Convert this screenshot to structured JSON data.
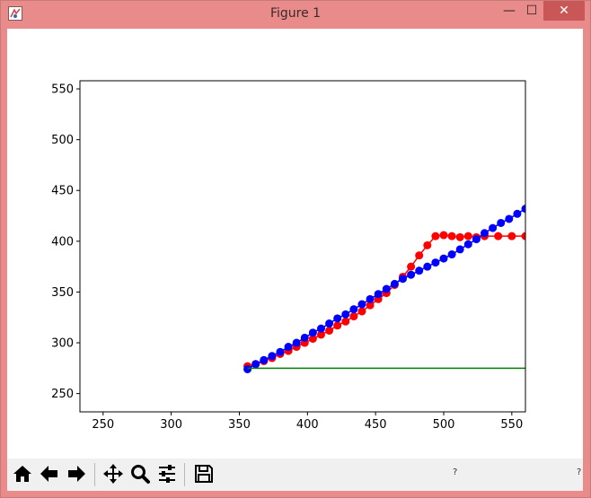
{
  "window": {
    "title": "Figure 1"
  },
  "controls": {
    "minimize": "—",
    "maximize": "☐",
    "close": "✕"
  },
  "toolbar": {
    "buttons": [
      {
        "name": "home-button",
        "icon": "home-icon"
      },
      {
        "name": "back-button",
        "icon": "arrow-left-icon"
      },
      {
        "name": "forward-button",
        "icon": "arrow-right-icon"
      },
      {
        "name": "pan-button",
        "icon": "move-icon"
      },
      {
        "name": "zoom-button",
        "icon": "magnifier-icon"
      },
      {
        "name": "configure-subplots-button",
        "icon": "sliders-icon"
      },
      {
        "name": "save-button",
        "icon": "floppy-disk-icon"
      }
    ],
    "status_left": "?",
    "status_right": "?"
  },
  "chart_data": {
    "type": "line",
    "xlim": [
      233,
      560
    ],
    "ylim": [
      232,
      558
    ],
    "xticks": [
      250,
      300,
      350,
      400,
      450,
      500,
      550
    ],
    "yticks": [
      250,
      300,
      350,
      400,
      450,
      500,
      550
    ],
    "grid": false,
    "series": [
      {
        "color": "#ff0000",
        "marker": "o",
        "x": [
          356,
          362,
          368,
          374,
          380,
          386,
          392,
          398,
          404,
          410,
          416,
          422,
          428,
          434,
          440,
          446,
          452,
          458,
          464,
          470,
          476,
          482,
          488,
          494,
          500,
          506,
          512,
          518,
          524,
          530,
          540,
          550,
          560
        ],
        "y": [
          277,
          279,
          282,
          285,
          289,
          292,
          296,
          300,
          304,
          308,
          312,
          317,
          321,
          326,
          331,
          337,
          343,
          349,
          357,
          365,
          375,
          386,
          396,
          405,
          406,
          405,
          404,
          405,
          404,
          405,
          405,
          405,
          405
        ]
      },
      {
        "color": "#0000ff",
        "marker": "o",
        "x": [
          356,
          362,
          368,
          374,
          380,
          386,
          392,
          398,
          404,
          410,
          416,
          422,
          428,
          434,
          440,
          446,
          452,
          458,
          464,
          470,
          476,
          482,
          488,
          494,
          500,
          506,
          512,
          518,
          524,
          530,
          536,
          542,
          548,
          554,
          560
        ],
        "y": [
          274,
          279,
          283,
          287,
          291,
          296,
          300,
          305,
          310,
          314,
          319,
          324,
          328,
          333,
          338,
          343,
          348,
          353,
          358,
          363,
          367,
          371,
          375,
          379,
          383,
          387,
          392,
          397,
          402,
          408,
          413,
          418,
          422,
          427,
          432
        ]
      },
      {
        "color": "#008000",
        "marker": "",
        "x": [
          356,
          560
        ],
        "y": [
          275,
          275
        ]
      }
    ]
  }
}
